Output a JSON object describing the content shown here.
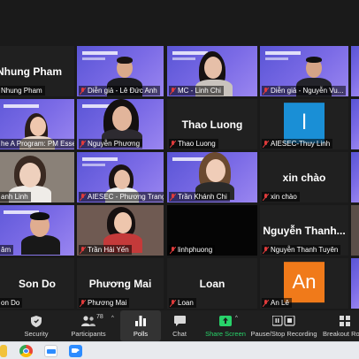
{
  "tiles": {
    "r1c1": {
      "bigname": "Nhung Pham",
      "nameplate": "Nhung Pham"
    },
    "r1c2": {
      "nameplate": "Diễn giả - Lê Đức Anh"
    },
    "r1c3": {
      "nameplate": "MC - Linh Chi"
    },
    "r1c4": {
      "nameplate": "Diễn giả - Nguyễn Vu..."
    },
    "r2c1": {
      "nameplate": "he A Program: PM Essen..."
    },
    "r2c2": {
      "nameplate": "Nguyễn Phương"
    },
    "r2c3": {
      "bigname": "Thao Luong",
      "nameplate": "Thao Luong"
    },
    "r2c4": {
      "nameplate": "AIESEC-Thuy Linh",
      "avatar_letter": "l"
    },
    "r3c1": {
      "nameplate": "anh Linh"
    },
    "r3c2": {
      "nameplate": "AIESEC - Phương Trang"
    },
    "r3c3": {
      "nameplate": "Trần Khánh Chi"
    },
    "r3c4": {
      "bigname": "xin chào",
      "nameplate": "xin chào"
    },
    "r4c1": {
      "nameplate": "âm"
    },
    "r4c2": {
      "nameplate": "Trần Hải Yến"
    },
    "r4c3": {
      "nameplate": "linhphuong"
    },
    "r4c4": {
      "bigname": "Nguyễn Thanh...",
      "nameplate": "Nguyễn Thanh Tuyên"
    },
    "r5c1": {
      "bigname": "Son Do",
      "nameplate": "on Do"
    },
    "r5c2": {
      "bigname": "Phương Mai",
      "nameplate": "Phương Mai"
    },
    "r5c3": {
      "bigname": "Loan",
      "nameplate": "Loan"
    },
    "r5c4": {
      "nameplate": "An Lê",
      "avatar_letter": "An"
    }
  },
  "toolbar": {
    "security": "Security",
    "participants": "Participants",
    "participants_count": "78",
    "polls": "Polls",
    "chat": "Chat",
    "share_screen": "Share Screen",
    "record": "Pause/Stop Recording",
    "breakout": "Breakout Roo"
  },
  "colors": {
    "active_border": "#b7d64b",
    "share_green": "#28d26a",
    "slide_purple": "#6e63e0",
    "avatar_blue": "#1a8fd6",
    "avatar_orange": "#f07a1a"
  },
  "icons": {
    "security": "shield-icon",
    "participants": "people-icon",
    "polls": "bar-chart-icon",
    "chat": "chat-bubble-icon",
    "share_screen": "share-arrow-icon",
    "record": "pause-stop-icon",
    "breakout": "grid-icon",
    "muted": "muted-mic-icon"
  }
}
